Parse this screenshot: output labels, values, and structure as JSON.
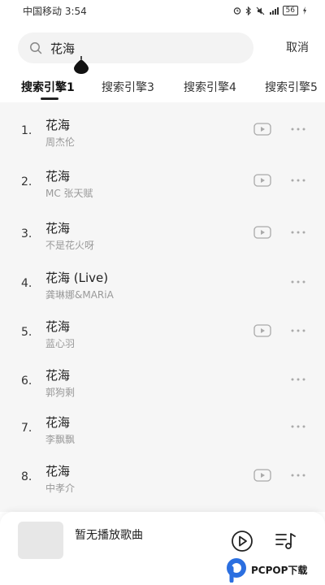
{
  "status_bar": {
    "carrier_time": "中国移动 3:54",
    "icons": [
      "alarm-icon",
      "bluetooth-icon",
      "mute-icon",
      "signal-icon"
    ],
    "battery": "56"
  },
  "search": {
    "value": "花海",
    "cancel_label": "取消"
  },
  "tabs": [
    {
      "label": "搜索引擎1",
      "active": true
    },
    {
      "label": "搜索引擎3",
      "active": false
    },
    {
      "label": "搜索引擎4",
      "active": false
    },
    {
      "label": "搜索引擎5",
      "active": false
    }
  ],
  "songs": [
    {
      "index": "1.",
      "title": "花海",
      "artist": "周杰伦",
      "has_mv": true
    },
    {
      "index": "2.",
      "title": "花海",
      "artist": "MC 张天赋",
      "has_mv": true
    },
    {
      "index": "3.",
      "title": "花海",
      "artist": "不是花火呀",
      "has_mv": true
    },
    {
      "index": "4.",
      "title": "花海 (Live)",
      "artist": "龚琳娜&MARiA",
      "has_mv": false
    },
    {
      "index": "5.",
      "title": "花海",
      "artist": "蓝心羽",
      "has_mv": true
    },
    {
      "index": "6.",
      "title": "花海",
      "artist": "郭狗剩",
      "has_mv": false
    },
    {
      "index": "7.",
      "title": "花海",
      "artist": "李飘飘",
      "has_mv": false
    },
    {
      "index": "8.",
      "title": "花海",
      "artist": "中孝介",
      "has_mv": true
    }
  ],
  "player": {
    "now_playing": "暂无播放歌曲"
  },
  "watermark": {
    "text": "PCPOP下载"
  },
  "colors": {
    "list_background": "#f6f6f6",
    "search_background": "#f3f3f3",
    "secondary_text": "#999999"
  }
}
